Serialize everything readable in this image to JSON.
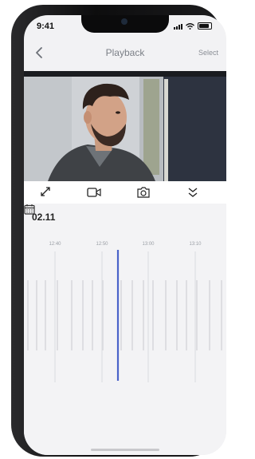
{
  "status_bar": {
    "time": "9:41"
  },
  "nav": {
    "title": "Playback",
    "select_label": "Select",
    "back_icon": "chevron-left-icon"
  },
  "controls": [
    "expand-icon",
    "video-record-icon",
    "camera-icon",
    "chevron-double-down-icon"
  ],
  "timeline": {
    "date": "02.11",
    "ticks": [
      "12:40",
      "12:50",
      "13:00",
      "13:10"
    ],
    "accent_color": "#4a63c9"
  }
}
